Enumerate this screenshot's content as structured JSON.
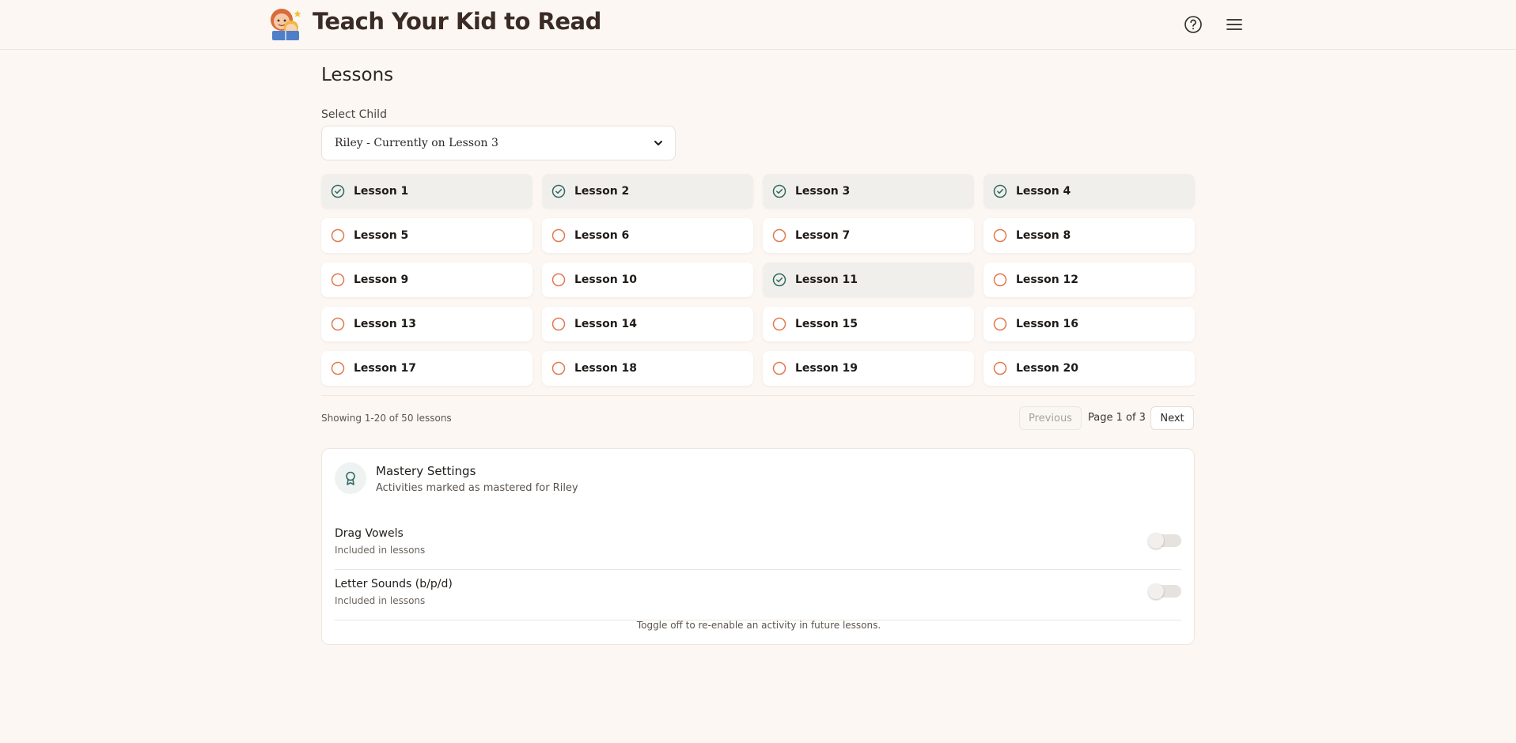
{
  "header": {
    "app_title": "Teach Your Kid to Read",
    "icons": [
      "logo",
      "help-icon",
      "menu-icon"
    ]
  },
  "main": {
    "title": "Lessons",
    "select_label": "Select Child",
    "selected_child": "Riley - Currently on Lesson 3"
  },
  "lessons": [
    {
      "label": "Lesson 1",
      "completed": true
    },
    {
      "label": "Lesson 2",
      "completed": true
    },
    {
      "label": "Lesson 3",
      "completed": true
    },
    {
      "label": "Lesson 4",
      "completed": true
    },
    {
      "label": "Lesson 5",
      "completed": false
    },
    {
      "label": "Lesson 6",
      "completed": false
    },
    {
      "label": "Lesson 7",
      "completed": false
    },
    {
      "label": "Lesson 8",
      "completed": false
    },
    {
      "label": "Lesson 9",
      "completed": false
    },
    {
      "label": "Lesson 10",
      "completed": false
    },
    {
      "label": "Lesson 11",
      "completed": true
    },
    {
      "label": "Lesson 12",
      "completed": false
    },
    {
      "label": "Lesson 13",
      "completed": false
    },
    {
      "label": "Lesson 14",
      "completed": false
    },
    {
      "label": "Lesson 15",
      "completed": false
    },
    {
      "label": "Lesson 16",
      "completed": false
    },
    {
      "label": "Lesson 17",
      "completed": false
    },
    {
      "label": "Lesson 18",
      "completed": false
    },
    {
      "label": "Lesson 19",
      "completed": false
    },
    {
      "label": "Lesson 20",
      "completed": false
    }
  ],
  "pagination": {
    "showing_text": "Showing 1-20 of 50 lessons",
    "previous_label": "Previous",
    "page_info": "Page 1 of 3",
    "next_label": "Next"
  },
  "mastery": {
    "title": "Mastery Settings",
    "subtitle": "Activities marked as mastered for Riley",
    "activities": [
      {
        "name": "Drag Vowels",
        "status": "Included in lessons",
        "mastered": false
      },
      {
        "name": "Letter Sounds (b/p/d)",
        "status": "Included in lessons",
        "mastered": false
      }
    ],
    "footnote": "Toggle off to re-enable an activity in future lessons."
  },
  "colors": {
    "background": "#fcf7f3",
    "completed_icon": "#2f6b63",
    "pending_icon": "#e07a4f",
    "card_border": "#ece6e0"
  }
}
